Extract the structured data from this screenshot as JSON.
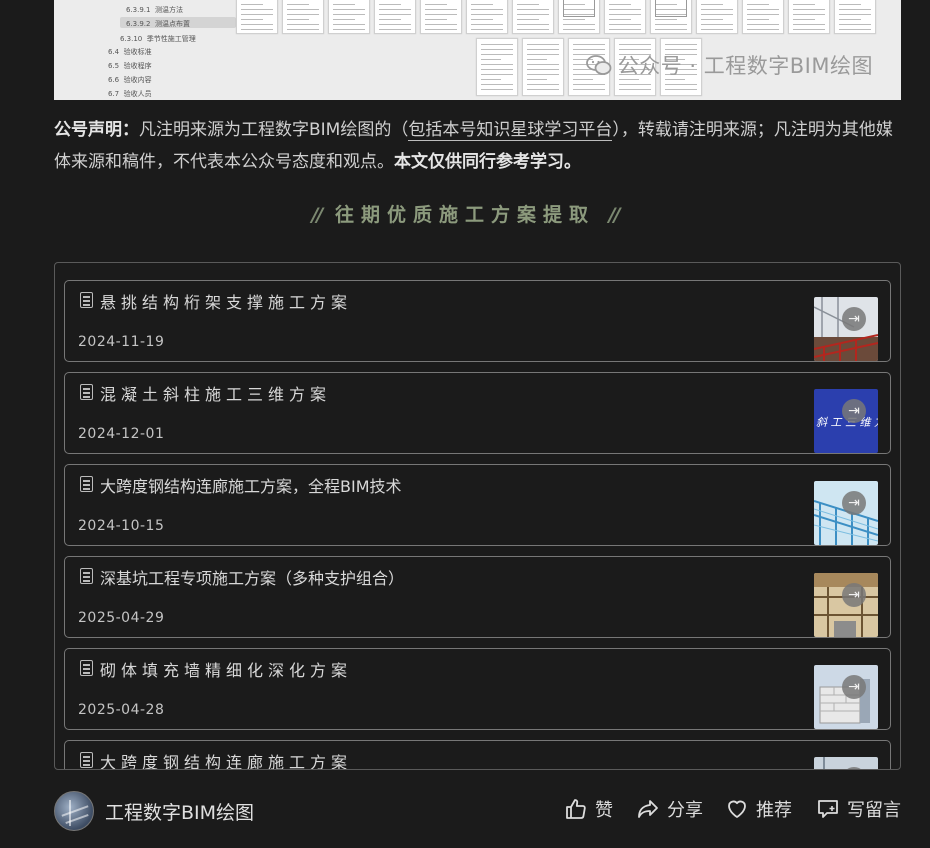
{
  "preview": {
    "toc": [
      {
        "num": "6.3.9.1",
        "label": "测温方法"
      },
      {
        "num": "6.3.9.2",
        "label": "测温点布置"
      },
      {
        "num": "6.3.10",
        "label": "季节性施工管理"
      },
      {
        "num": "6.4",
        "label": "验收标准"
      },
      {
        "num": "6.5",
        "label": "验收程序"
      },
      {
        "num": "6.6",
        "label": "验收内容"
      },
      {
        "num": "6.7",
        "label": "验收人员"
      }
    ],
    "watermark": "公众号 · 工程数字BIM绘图"
  },
  "declaration": {
    "label": "公号声明：",
    "text1": "凡注明来源为工程数字BIM绘图的（",
    "link": "包括本号知识星球学习平台",
    "text2": "），转载请注明来源；凡注明为其他媒体来源和稿件，不代表本公众号态度和观点。",
    "bold": "本文仅供同行参考学习。"
  },
  "section_title": "往期优质施工方案提取",
  "articles": [
    {
      "title": "悬挑结构桁架支撑施工方案",
      "date": "2024-11-19",
      "thumb": "truss-icon",
      "spaced": true
    },
    {
      "title": "混凝土斜柱施工三维方案",
      "date": "2024-12-01",
      "thumb": "blue-title-icon",
      "thumb_text": "斜 工 三 维 方 ",
      "spaced": true
    },
    {
      "title": "大跨度钢结构连廊施工方案，全程BIM技术",
      "date": "2024-10-15",
      "thumb": "steel-bridge-icon",
      "spaced": false
    },
    {
      "title": "深基坑工程专项施工方案（多种支护组合）",
      "date": "2025-04-29",
      "thumb": "excavation-icon",
      "spaced": false
    },
    {
      "title": "砌体填充墙精细化深化方案",
      "date": "2025-04-28",
      "thumb": "masonry-icon",
      "spaced": true
    },
    {
      "title": "大跨度钢结构连廊施工方案",
      "date": "",
      "thumb": "steel-bridge-icon",
      "spaced": true
    }
  ],
  "bottom": {
    "account": "工程数字BIM绘图",
    "like": "赞",
    "share": "分享",
    "recommend": "推荐",
    "comment": "写留言"
  },
  "colors": {
    "background": "#1b1b1b",
    "title_accent": "#8c9a7d",
    "card_border": "#777777"
  }
}
